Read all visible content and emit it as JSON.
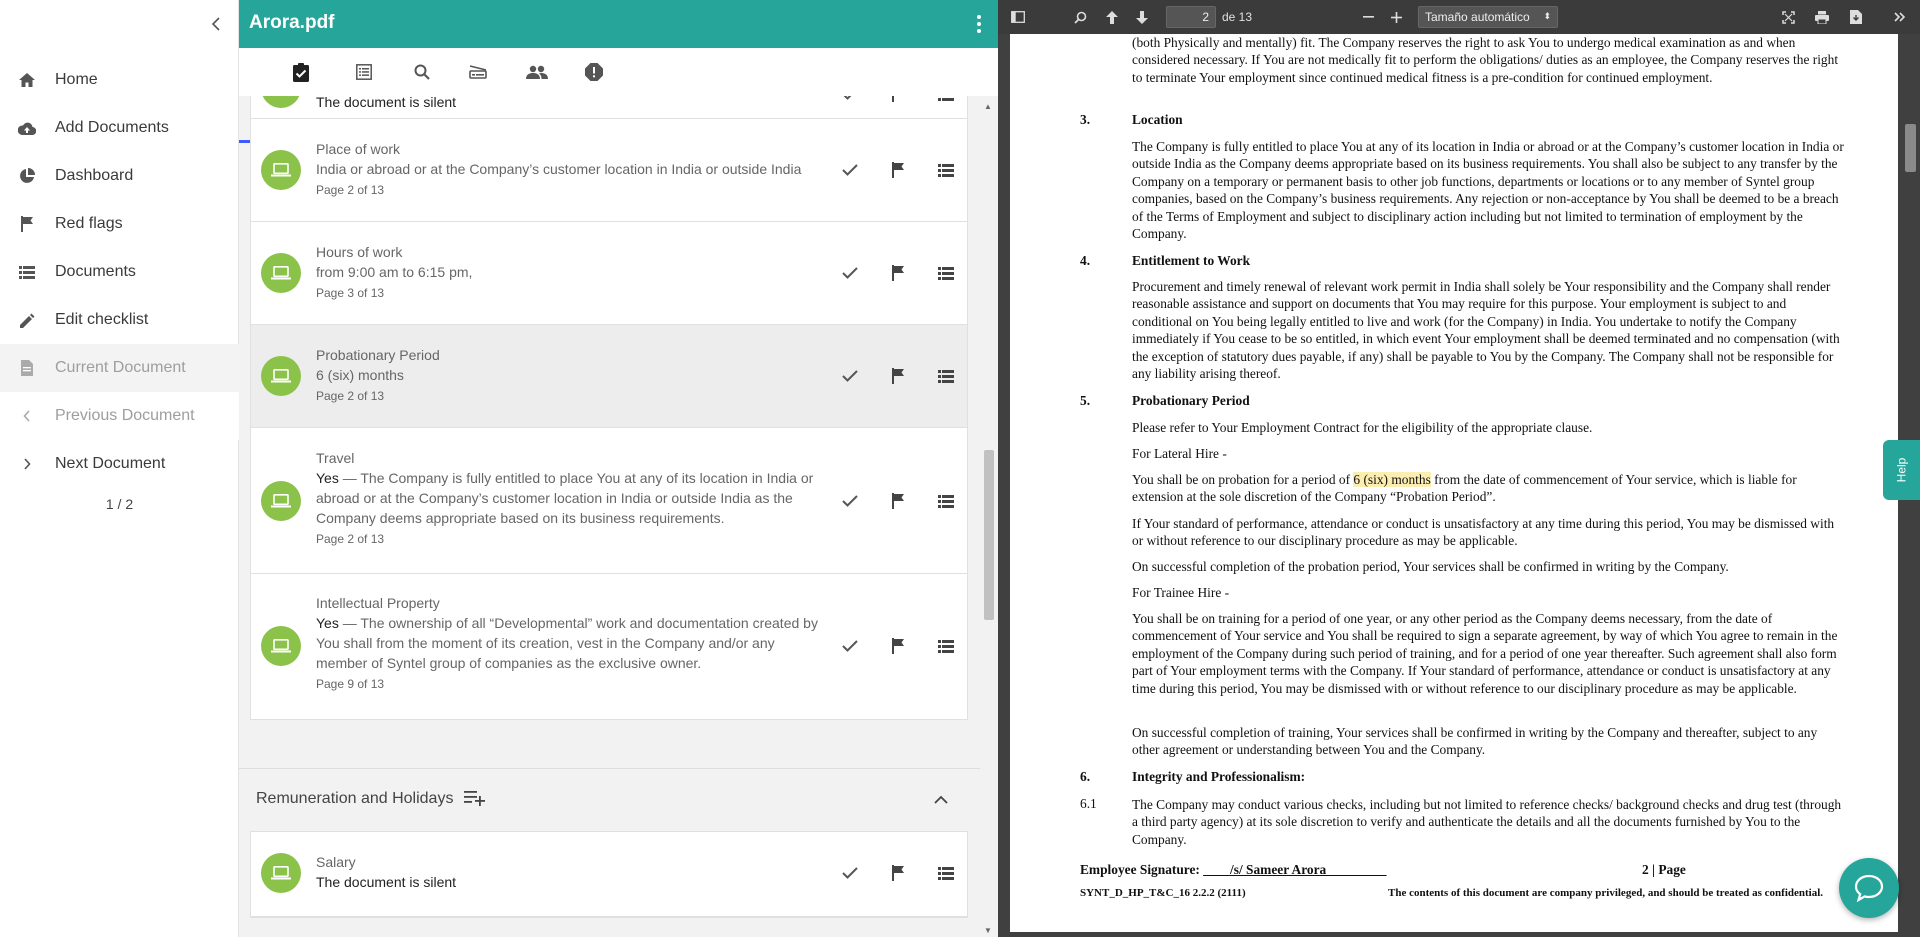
{
  "sidebar": {
    "items": [
      {
        "label": "Home",
        "icon": "home-icon"
      },
      {
        "label": "Add Documents",
        "icon": "cloud-upload-icon"
      },
      {
        "label": "Dashboard",
        "icon": "pie-chart-icon"
      },
      {
        "label": "Red flags",
        "icon": "flag-icon"
      },
      {
        "label": "Documents",
        "icon": "list-icon"
      },
      {
        "label": "Edit checklist",
        "icon": "pencil-icon"
      },
      {
        "label": "Current Document",
        "icon": "document-icon"
      },
      {
        "label": "Previous Document",
        "icon": "chevron-left-icon"
      },
      {
        "label": "Next Document",
        "icon": "chevron-right-icon"
      }
    ],
    "pager": "1 / 2"
  },
  "header": {
    "title": "Arora.pdf",
    "accent_color": "#26a69a"
  },
  "tabs": [
    {
      "icon": "checklist-icon"
    },
    {
      "icon": "table-icon"
    },
    {
      "icon": "search-icon"
    },
    {
      "icon": "scanner-icon"
    },
    {
      "icon": "people-icon"
    },
    {
      "icon": "alert-icon"
    }
  ],
  "checklist": {
    "items": [
      {
        "title": "",
        "value": "The document is silent",
        "page": ""
      },
      {
        "title": "Place of work",
        "value": "India or abroad or at the Company’s customer location in India or outside India",
        "page": "Page 2 of 13"
      },
      {
        "title": "Hours of work",
        "value": "from 9:00 am to 6:15 pm,",
        "page": "Page 3 of 13"
      },
      {
        "title": "Probationary Period",
        "value": "6 (six) months",
        "page": "Page 2 of 13"
      },
      {
        "title": "Travel",
        "answer": "Yes",
        "value": " — The Company is fully entitled to place You at any of its location in India or abroad or at the Company’s customer location in India or outside India as the Company deems appropriate based on its business requirements.",
        "page": "Page 2 of 13"
      },
      {
        "title": "Intellectual Property",
        "answer": "Yes",
        "value": " — The ownership of all “Developmental” work and documentation created by You shall from the moment of its creation, vest in the Company and/or any member of Syntel group of companies as the exclusive owner.",
        "page": "Page 9 of 13"
      }
    ],
    "section": {
      "title": "Remuneration and Holidays"
    },
    "section_items": [
      {
        "title": "Salary",
        "value": "The document is silent",
        "page": ""
      }
    ]
  },
  "viewer": {
    "page_number": "2",
    "page_total": "de 13",
    "zoom": "Tamaño automático",
    "help_label": "Help",
    "intro": "(both Physically and mentally) fit. The Company reserves the right to ask You to undergo medical examination as and when considered necessary. If You are not medically fit to perform the obligations/ duties as an employee, the Company reserves the right to terminate Your employment since continued medical fitness is a pre-condition for continued employment.",
    "s3_num": "3.",
    "s3_head": "Location",
    "s3_body": "The Company is fully entitled to place You at any of its location in India or abroad or at the Company’s customer location in India or outside India as the Company deems appropriate based on its business requirements. You shall also be subject to any transfer by the Company on a temporary or permanent basis to other job functions, departments or locations or to any member of Syntel group companies, based on the Company’s business requirements. Any rejection or non-acceptance by You shall be deemed to be a breach of the Terms of Employment and subject to disciplinary action including but not limited to termination of employment by the Company.",
    "s4_num": "4.",
    "s4_head": "Entitlement to Work",
    "s4_body": "Procurement and timely renewal of relevant work permit in India shall solely be Your responsibility and the Company shall render reasonable assistance and support on documents that You may require for this purpose. Your employment is subject to and conditional on You being legally entitled to live and work (for the Company) in India. You undertake to notify the Company immediately if You cease to be so entitled, in which event Your employment shall be deemed terminated and no compensation (with the exception of statutory dues payable, if any) shall be payable to You by the Company. The Company shall not be responsible for any liability arising thereof.",
    "s5_num": "5.",
    "s5_head": "Probationary Period",
    "s5_p1": "Please refer to Your Employment Contract for the eligibility of the appropriate clause.",
    "s5_p2": "For Lateral Hire -",
    "s5_p3a": "You shall be on probation for a period of ",
    "s5_p3_hl": "6 (six) months",
    "s5_p3b": " from the date of commencement of Your service, which is liable for extension at the sole discretion of the Company “Probation Period”.",
    "s5_p4": "If Your standard of performance, attendance or conduct is unsatisfactory at any time during this period, You may be dismissed with or without reference to our disciplinary procedure as may be applicable.",
    "s5_p5": "On successful completion of the probation period, Your services shall be confirmed in writing by the Company.",
    "s5_p6": "For Trainee Hire -",
    "s5_p7": "You shall be on training for a period of one year, or any other period as the Company deems necessary, from the date of commencement of Your service and You shall be required to sign a separate agreement, by way of which You agree to remain in the employment of the Company during such period of training, and for a period of one year thereafter. Such agreement shall also form part of Your employment terms with the Company. If Your standard of performance, attendance or conduct is unsatisfactory at any time during this period, You may be dismissed with or without reference to our disciplinary procedure as may be applicable.",
    "s5_p8": "On successful completion of training, Your services shall be confirmed in writing by the Company and thereafter, subject to any other agreement or understanding between You and the Company.",
    "s6_num": "6.",
    "s6_head": "Integrity and Professionalism:",
    "s61_num": "6.1",
    "s61_body": "The Company may conduct various checks, including but not limited to reference checks/ background checks and drug test (through a third party agency) at its sole discretion to verify and authenticate the details and all the documents furnished by You to the Company.",
    "sig_label": "Employee Signature: ",
    "sig_value": "____/s/ Sameer Arora_________",
    "page_label": "2 | Page",
    "doc_code": "SYNT_D_HP_T&C_16 2.2.2 (2111)",
    "confidential": "The contents of this document are company privileged, and should be treated as confidential."
  }
}
